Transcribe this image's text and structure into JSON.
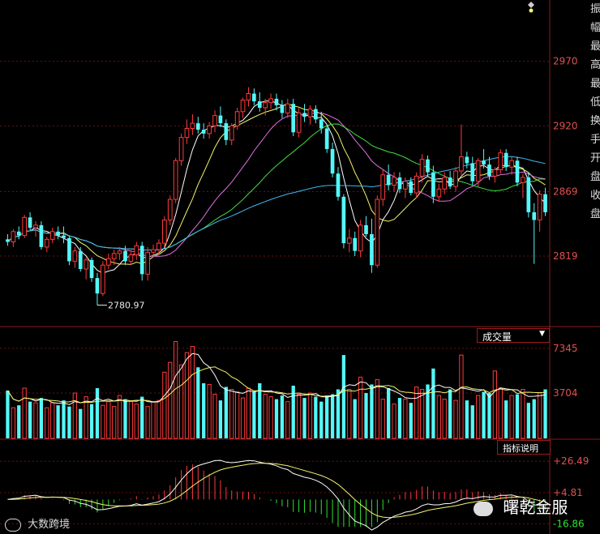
{
  "chart_data": [
    {
      "type": "candlestick",
      "panel": "price",
      "y_ticks": [
        2970,
        2920,
        2869,
        2819
      ],
      "ylim": [
        2765,
        3005
      ],
      "annotations": [
        {
          "text": "2780.97",
          "value": 2780.97
        }
      ],
      "series": [
        {
          "name": "MA5",
          "color": "#ffffff"
        },
        {
          "name": "MA10",
          "color": "#f5f56a"
        },
        {
          "name": "MA20",
          "color": "#e070e0"
        },
        {
          "name": "MA30",
          "color": "#40e040"
        },
        {
          "name": "MA60",
          "color": "#40b8f0"
        }
      ],
      "candles": [
        [
          2832,
          2836,
          2827,
          2830
        ],
        [
          2830,
          2840,
          2826,
          2838
        ],
        [
          2838,
          2842,
          2832,
          2835
        ],
        [
          2835,
          2851,
          2833,
          2849
        ],
        [
          2849,
          2853,
          2839,
          2841
        ],
        [
          2841,
          2846,
          2834,
          2843
        ],
        [
          2843,
          2846,
          2824,
          2826
        ],
        [
          2826,
          2834,
          2822,
          2832
        ],
        [
          2832,
          2841,
          2829,
          2838
        ],
        [
          2838,
          2842,
          2832,
          2835
        ],
        [
          2835,
          2842,
          2829,
          2833
        ],
        [
          2833,
          2835,
          2812,
          2815
        ],
        [
          2815,
          2826,
          2810,
          2823
        ],
        [
          2823,
          2826,
          2807,
          2809
        ],
        [
          2809,
          2818,
          2801,
          2816
        ],
        [
          2816,
          2818,
          2799,
          2802
        ],
        [
          2802,
          2806,
          2781,
          2790
        ],
        [
          2790,
          2815,
          2788,
          2812
        ],
        [
          2812,
          2821,
          2809,
          2817
        ],
        [
          2817,
          2824,
          2812,
          2821
        ],
        [
          2821,
          2826,
          2816,
          2823
        ],
        [
          2823,
          2827,
          2812,
          2815
        ],
        [
          2815,
          2823,
          2812,
          2820
        ],
        [
          2820,
          2830,
          2816,
          2827
        ],
        [
          2827,
          2830,
          2800,
          2805
        ],
        [
          2805,
          2826,
          2800,
          2822
        ],
        [
          2822,
          2828,
          2818,
          2824
        ],
        [
          2824,
          2832,
          2820,
          2829
        ],
        [
          2829,
          2850,
          2826,
          2847
        ],
        [
          2847,
          2866,
          2843,
          2863
        ],
        [
          2863,
          2895,
          2860,
          2893
        ],
        [
          2893,
          2914,
          2889,
          2911
        ],
        [
          2911,
          2925,
          2906,
          2918
        ],
        [
          2918,
          2929,
          2913,
          2922
        ],
        [
          2922,
          2927,
          2914,
          2917
        ],
        [
          2917,
          2922,
          2910,
          2914
        ],
        [
          2914,
          2923,
          2910,
          2920
        ],
        [
          2920,
          2932,
          2915,
          2928
        ],
        [
          2928,
          2935,
          2919,
          2922
        ],
        [
          2922,
          2925,
          2905,
          2909
        ],
        [
          2909,
          2922,
          2905,
          2920
        ],
        [
          2920,
          2934,
          2917,
          2931
        ],
        [
          2931,
          2942,
          2926,
          2940
        ],
        [
          2940,
          2950,
          2935,
          2945
        ],
        [
          2945,
          2949,
          2936,
          2939
        ],
        [
          2939,
          2946,
          2931,
          2934
        ],
        [
          2934,
          2941,
          2928,
          2938
        ],
        [
          2938,
          2945,
          2933,
          2941
        ],
        [
          2941,
          2945,
          2932,
          2936
        ],
        [
          2936,
          2940,
          2926,
          2930
        ],
        [
          2930,
          2941,
          2926,
          2937
        ],
        [
          2937,
          2941,
          2912,
          2915
        ],
        [
          2915,
          2934,
          2911,
          2930
        ],
        [
          2930,
          2937,
          2923,
          2927
        ],
        [
          2927,
          2936,
          2921,
          2933
        ],
        [
          2933,
          2936,
          2922,
          2925
        ],
        [
          2925,
          2931,
          2914,
          2918
        ],
        [
          2918,
          2921,
          2899,
          2902
        ],
        [
          2902,
          2907,
          2880,
          2883
        ],
        [
          2883,
          2888,
          2862,
          2865
        ],
        [
          2865,
          2867,
          2825,
          2829
        ],
        [
          2829,
          2840,
          2822,
          2833
        ],
        [
          2833,
          2838,
          2819,
          2823
        ],
        [
          2823,
          2847,
          2818,
          2843
        ],
        [
          2843,
          2850,
          2834,
          2836
        ],
        [
          2836,
          2848,
          2806,
          2812
        ],
        [
          2812,
          2866,
          2810,
          2863
        ],
        [
          2863,
          2886,
          2858,
          2882
        ],
        [
          2882,
          2890,
          2870,
          2874
        ],
        [
          2874,
          2884,
          2869,
          2880
        ],
        [
          2880,
          2884,
          2868,
          2871
        ],
        [
          2871,
          2880,
          2864,
          2877
        ],
        [
          2877,
          2880,
          2866,
          2868
        ],
        [
          2868,
          2884,
          2864,
          2881
        ],
        [
          2881,
          2898,
          2876,
          2894
        ],
        [
          2894,
          2897,
          2881,
          2884
        ],
        [
          2884,
          2889,
          2860,
          2865
        ],
        [
          2865,
          2875,
          2861,
          2871
        ],
        [
          2871,
          2884,
          2867,
          2880
        ],
        [
          2880,
          2885,
          2871,
          2873
        ],
        [
          2873,
          2888,
          2869,
          2885
        ],
        [
          2885,
          2921,
          2882,
          2896
        ],
        [
          2896,
          2900,
          2887,
          2891
        ],
        [
          2891,
          2896,
          2874,
          2877
        ],
        [
          2877,
          2895,
          2873,
          2893
        ],
        [
          2893,
          2902,
          2887,
          2890
        ],
        [
          2890,
          2896,
          2878,
          2881
        ],
        [
          2881,
          2888,
          2876,
          2886
        ],
        [
          2886,
          2902,
          2883,
          2899
        ],
        [
          2899,
          2902,
          2885,
          2888
        ],
        [
          2888,
          2896,
          2882,
          2893
        ],
        [
          2893,
          2896,
          2873,
          2876
        ],
        [
          2876,
          2883,
          2864,
          2880
        ],
        [
          2880,
          2884,
          2849,
          2853
        ],
        [
          2853,
          2860,
          2813,
          2847
        ],
        [
          2847,
          2870,
          2838,
          2867
        ],
        [
          2867,
          2872,
          2850,
          2853
        ]
      ]
    },
    {
      "type": "bar",
      "panel": "volume",
      "y_ticks": [
        7345,
        3704
      ],
      "ylim": [
        0,
        8000
      ],
      "legend": "成交量",
      "series": [
        {
          "name": "MA5",
          "color": "#ffffff"
        },
        {
          "name": "MA10",
          "color": "#f5f56a"
        }
      ],
      "values": [
        3900,
        2500,
        2700,
        4100,
        3000,
        2900,
        3300,
        2500,
        2900,
        2700,
        3100,
        2600,
        3700,
        2400,
        3400,
        2800,
        4100,
        2700,
        3000,
        2600,
        3500,
        3200,
        3000,
        2800,
        3400,
        2600,
        3000,
        3100,
        5400,
        6200,
        7900,
        6000,
        7000,
        7500,
        5800,
        4500,
        4400,
        3600,
        3100,
        4200,
        4000,
        3800,
        3300,
        4100,
        3800,
        4500,
        3600,
        3400,
        3200,
        3500,
        3000,
        4300,
        3600,
        3300,
        3700,
        3400,
        3000,
        3500,
        3600,
        4000,
        6800,
        4000,
        3200,
        5000,
        3700,
        4400,
        4800,
        3200,
        4100,
        2800,
        3300,
        3200,
        2900,
        4200,
        4000,
        4400,
        5700,
        3500,
        3200,
        4000,
        3100,
        6800,
        3100,
        2700,
        3500,
        3800,
        3700,
        5500,
        4100,
        3100,
        3500,
        3600,
        4000,
        2900,
        3200,
        3700,
        4000,
        6700,
        4700,
        4200,
        2400
      ]
    },
    {
      "type": "bar",
      "panel": "macd",
      "y_ticks": [
        26.49,
        4.81,
        -16.86
      ],
      "ylim": [
        -20,
        30
      ],
      "legend": "指标说明"
    }
  ],
  "buttons": {
    "volume": "成交量",
    "indicator": "指标说明"
  },
  "watermark": {
    "left": "大数跨境",
    "right": "曙乾金服"
  },
  "side_text": "振幅最高最低换手开盘收盘"
}
